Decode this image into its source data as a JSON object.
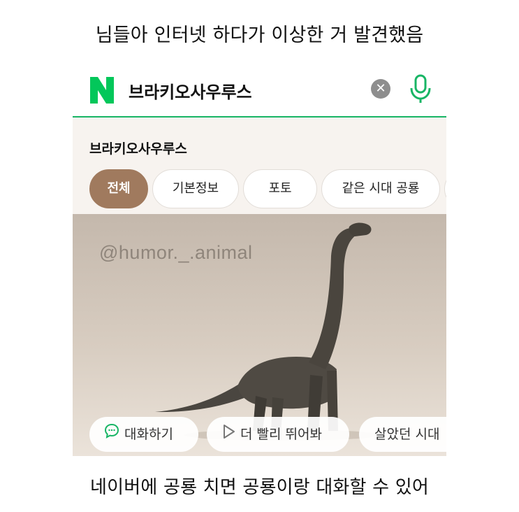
{
  "caption_top": "님들아 인터넷 하다가 이상한 거 발견했음",
  "caption_bottom": "네이버에 공룡 치면 공룡이랑 대화할 수 있어",
  "search": {
    "logo": "N",
    "query": "브라키오사우루스",
    "clear_icon": "close-circle-icon",
    "mic_icon": "microphone-icon",
    "accent": "#18b565"
  },
  "result": {
    "title": "브라키오사우루스",
    "tabs": [
      {
        "label": "전체",
        "active": true
      },
      {
        "label": "기본정보"
      },
      {
        "label": "포토"
      },
      {
        "label": "같은 시대 공룡"
      }
    ],
    "active_tab_color": "#a07a5e",
    "watermark": "@humor._.animal",
    "chips": [
      {
        "label": "대화하기",
        "icon": "chat-bubble-icon"
      },
      {
        "label": "더 빨리 뛰어봐",
        "icon": "play-icon"
      },
      {
        "label": "살았던 시대"
      }
    ]
  }
}
